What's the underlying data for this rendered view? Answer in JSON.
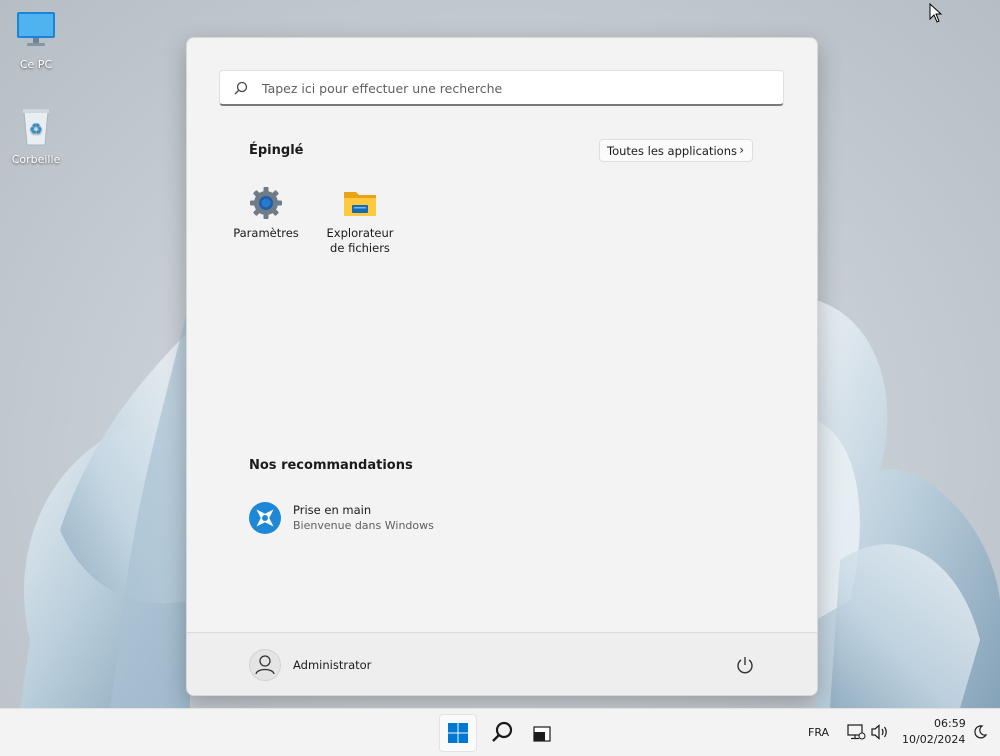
{
  "desktop": {
    "icons": [
      {
        "label": "Ce PC",
        "icon": "monitor-icon"
      },
      {
        "label": "Corbeille",
        "icon": "recycle-bin-icon"
      }
    ]
  },
  "start_menu": {
    "search": {
      "placeholder": "Tapez ici pour effectuer une recherche",
      "icon": "search-icon"
    },
    "pinned": {
      "title": "Épinglé",
      "all_apps_label": "Toutes les applications",
      "apps": [
        {
          "label": "Paramètres",
          "icon": "gear-icon"
        },
        {
          "label": "Explorateur de fichiers",
          "icon": "folder-icon"
        }
      ]
    },
    "recommended": {
      "title": "Nos recommandations",
      "items": [
        {
          "title": "Prise en main",
          "subtitle": "Bienvenue dans Windows",
          "icon": "get-started-icon"
        }
      ]
    },
    "footer": {
      "user": "Administrator",
      "power_icon": "power-icon"
    }
  },
  "taskbar": {
    "buttons": [
      "windows-start-icon",
      "search-icon",
      "task-view-icon"
    ],
    "language": "FRA",
    "time": "06:59",
    "date": "10/02/2024",
    "accent": "#0078d4"
  }
}
